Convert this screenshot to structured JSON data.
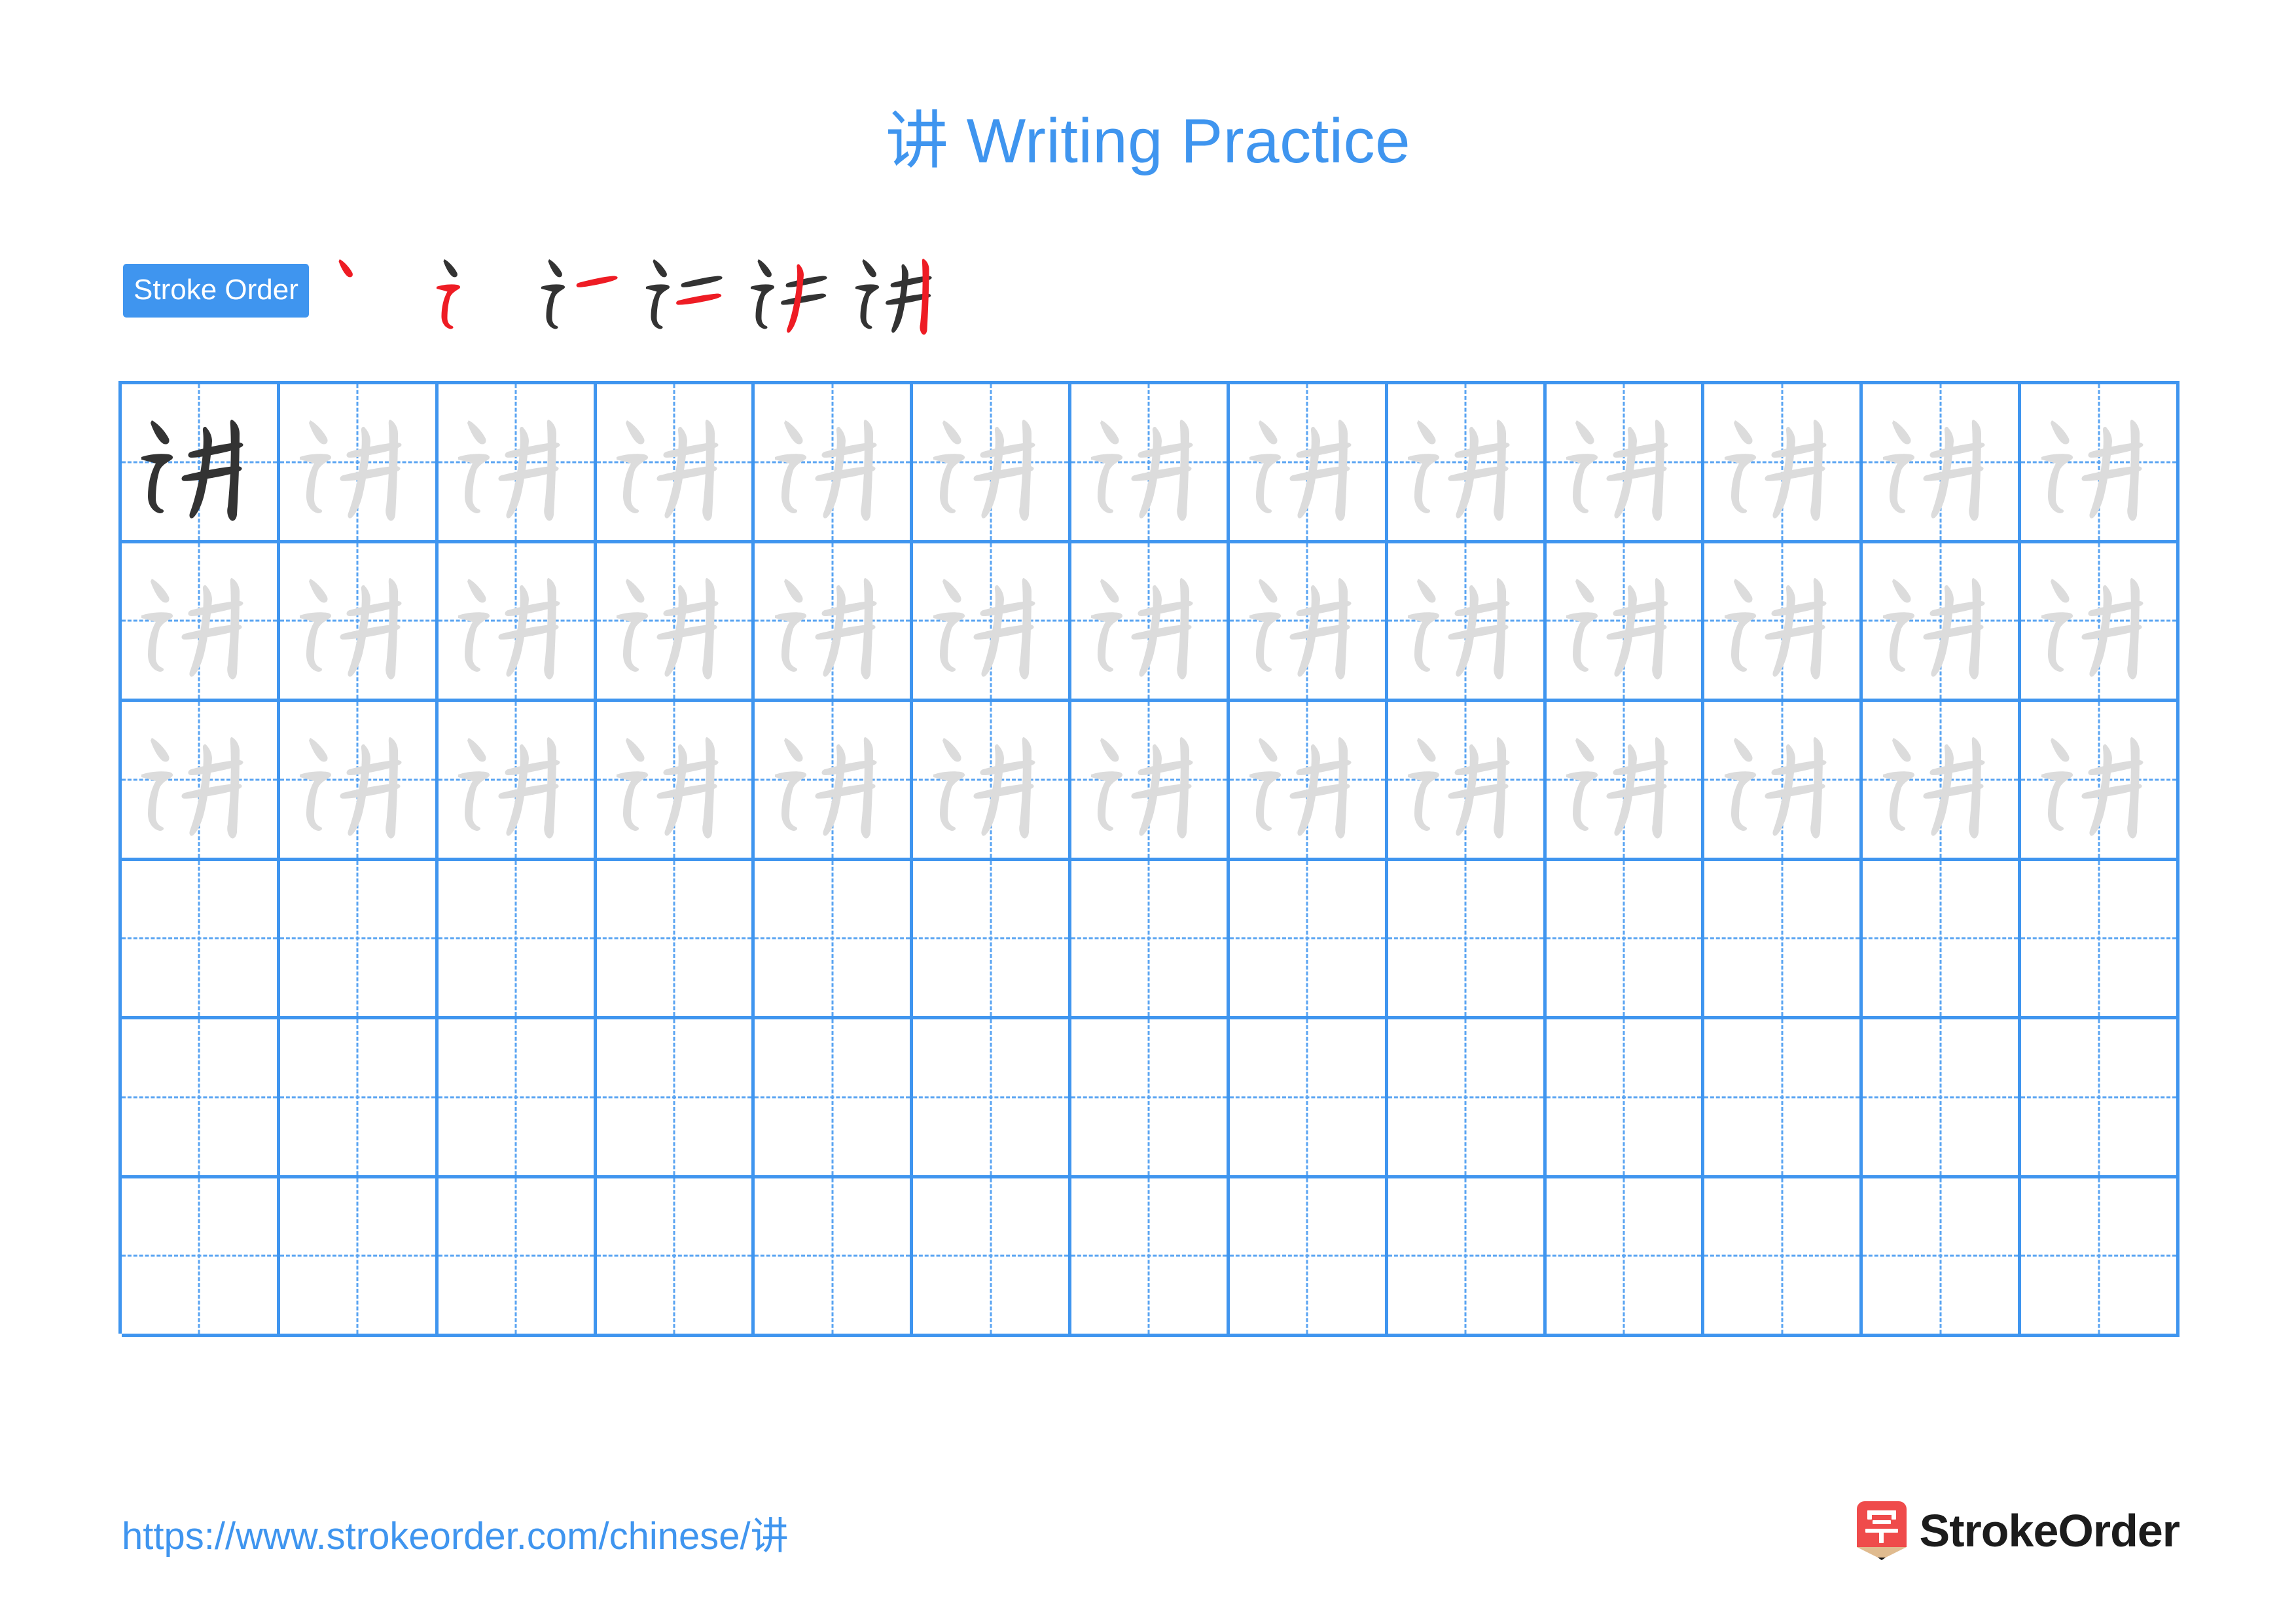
{
  "page": {
    "title": "讲 Writing Practice",
    "character": "讲",
    "background_color": "#ffffff",
    "accent_color": "#3f95ef"
  },
  "stroke_order": {
    "badge_label": "Stroke Order",
    "badge_bg_color": "#3f95ef",
    "badge_text_color": "#ffffff",
    "new_stroke_color": "#ee1c24",
    "existing_stroke_color": "#333333",
    "total_strokes": 6,
    "steps": [
      {
        "index": 1,
        "strokes_shown": 1,
        "partial_glyph": "丶"
      },
      {
        "index": 2,
        "strokes_shown": 2,
        "partial_glyph": "讠"
      },
      {
        "index": 3,
        "strokes_shown": 3,
        "partial_glyph": "讠一"
      },
      {
        "index": 4,
        "strokes_shown": 4,
        "partial_glyph": "讠二"
      },
      {
        "index": 5,
        "strokes_shown": 5,
        "partial_glyph": "讠丰"
      },
      {
        "index": 6,
        "strokes_shown": 6,
        "partial_glyph": "讲"
      }
    ]
  },
  "practice_grid": {
    "columns": 13,
    "rows": 6,
    "grid_line_color": "#3f95ef",
    "guide_line_color": "#5aa4f2",
    "model_glyph_color": "#333333",
    "trace_glyph_color": "#dcdcdc",
    "row_types": [
      "model-then-trace",
      "trace",
      "trace",
      "blank",
      "blank",
      "blank"
    ]
  },
  "footer": {
    "url": "https://www.strokeorder.com/chinese/讲",
    "url_color": "#3f95ef",
    "brand_name": "StrokeOrder",
    "brand_mark_character": "字",
    "brand_mark_color": "#ef4b4b",
    "brand_mark_tip_color": "#e0bb8f"
  }
}
